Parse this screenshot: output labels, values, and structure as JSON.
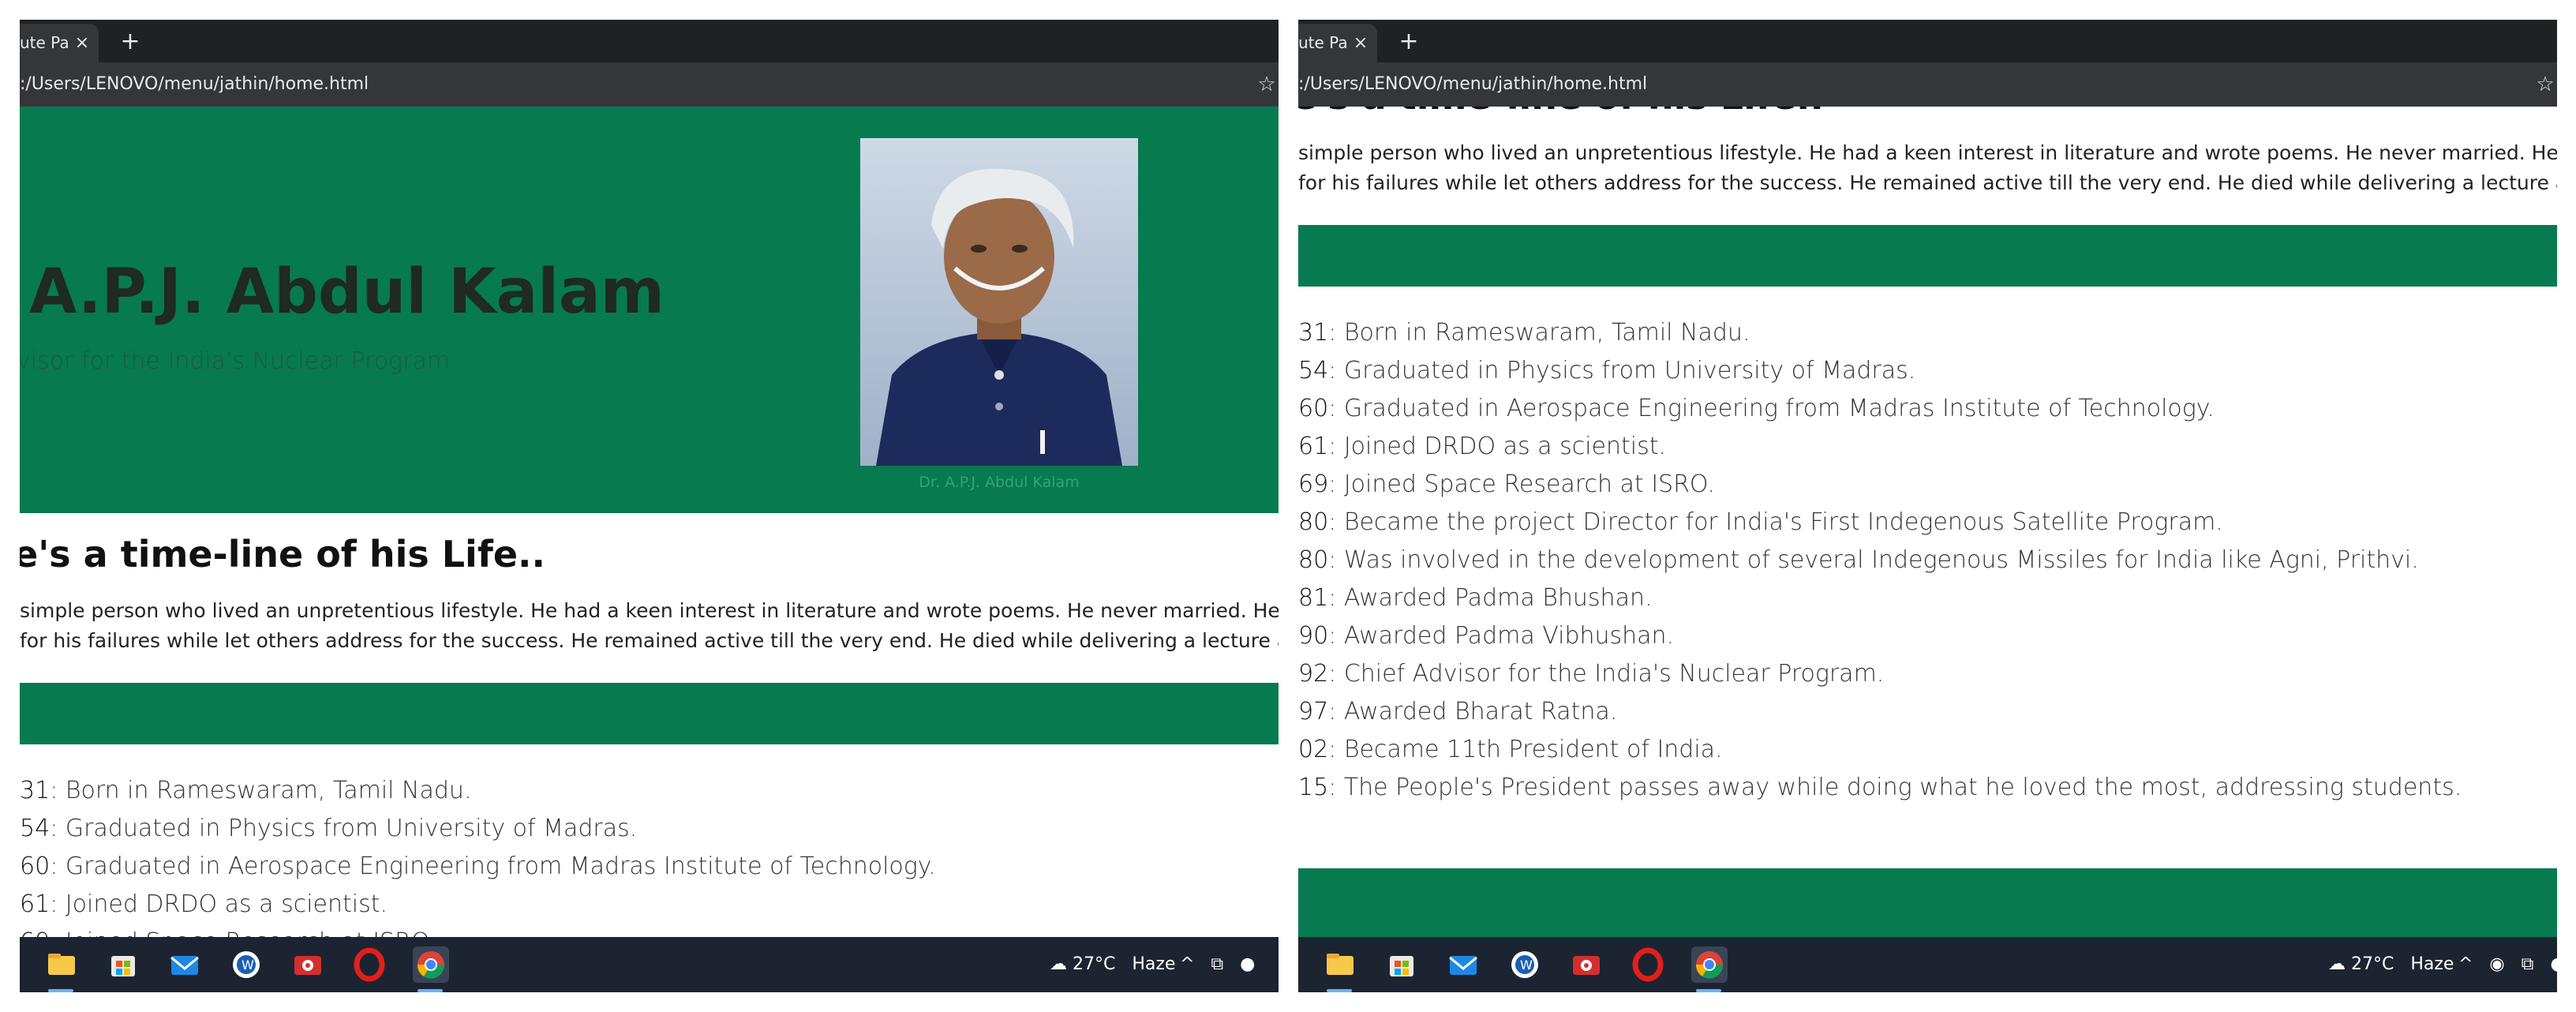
{
  "browser": {
    "tab_title": "ute Pa",
    "tab_close": "×",
    "new_tab": "+",
    "url": ":/Users/LENOVO/menu/jathin/home.html",
    "star": "☆"
  },
  "hero": {
    "name": "A.P.J. Abdul Kalam",
    "subtitle": "visor for the India's Nuclear Program.",
    "caption": "Dr. A.P.J. Abdul Kalam"
  },
  "timeline": {
    "heading": "e's a time-line of his Life..",
    "heading_clipped": "e's a time-line of his Life..",
    "bio_line1": "simple person who lived an unpretentious lifestyle. He had a keen interest in literature and wrote poems. He never married. He always faced m",
    "bio_line2": " for his failures while let others address for the success. He remained active till the very end. He died while delivering a lecture at the IIM."
  },
  "events": [
    {
      "year": "31",
      "text": ": Born in Rameswaram, Tamil Nadu."
    },
    {
      "year": "54",
      "text": ": Graduated in Physics from University of Madras."
    },
    {
      "year": "60",
      "text": ": Graduated in Aerospace Engineering from Madras Institute of Technology."
    },
    {
      "year": "61",
      "text": ": Joined DRDO as a scientist."
    },
    {
      "year": "69",
      "text": ": Joined Space Research at ISRO."
    },
    {
      "year": "80",
      "text": ": Became the project Director for India's First Indegenous Satellite Program."
    },
    {
      "year": "80",
      "text": ": Was involved in the development of several Indegenous Missiles for India like Agni, Prithvi."
    },
    {
      "year": "81",
      "text": ": Awarded Padma Bhushan."
    },
    {
      "year": "90",
      "text": ": Awarded Padma Vibhushan."
    },
    {
      "year": "92",
      "text": ": Chief Advisor for the India's Nuclear Program."
    },
    {
      "year": "97",
      "text": ": Awarded Bharat Ratna."
    },
    {
      "year": "02",
      "text": ": Became 11th President of India."
    },
    {
      "year": "15",
      "text": ": The People's President passes away while doing what he loved the most, addressing students."
    }
  ],
  "taskbar": {
    "weather_temp": "27°C",
    "weather_desc": "Haze",
    "apps": [
      "file-explorer-icon",
      "store-icon",
      "mail-icon",
      "word-icon",
      "camera-icon",
      "opera-icon",
      "chrome-icon"
    ]
  },
  "colors": {
    "accent_green": "#087a4f",
    "chrome_dark": "#202124",
    "taskbar": "#1c2432"
  }
}
